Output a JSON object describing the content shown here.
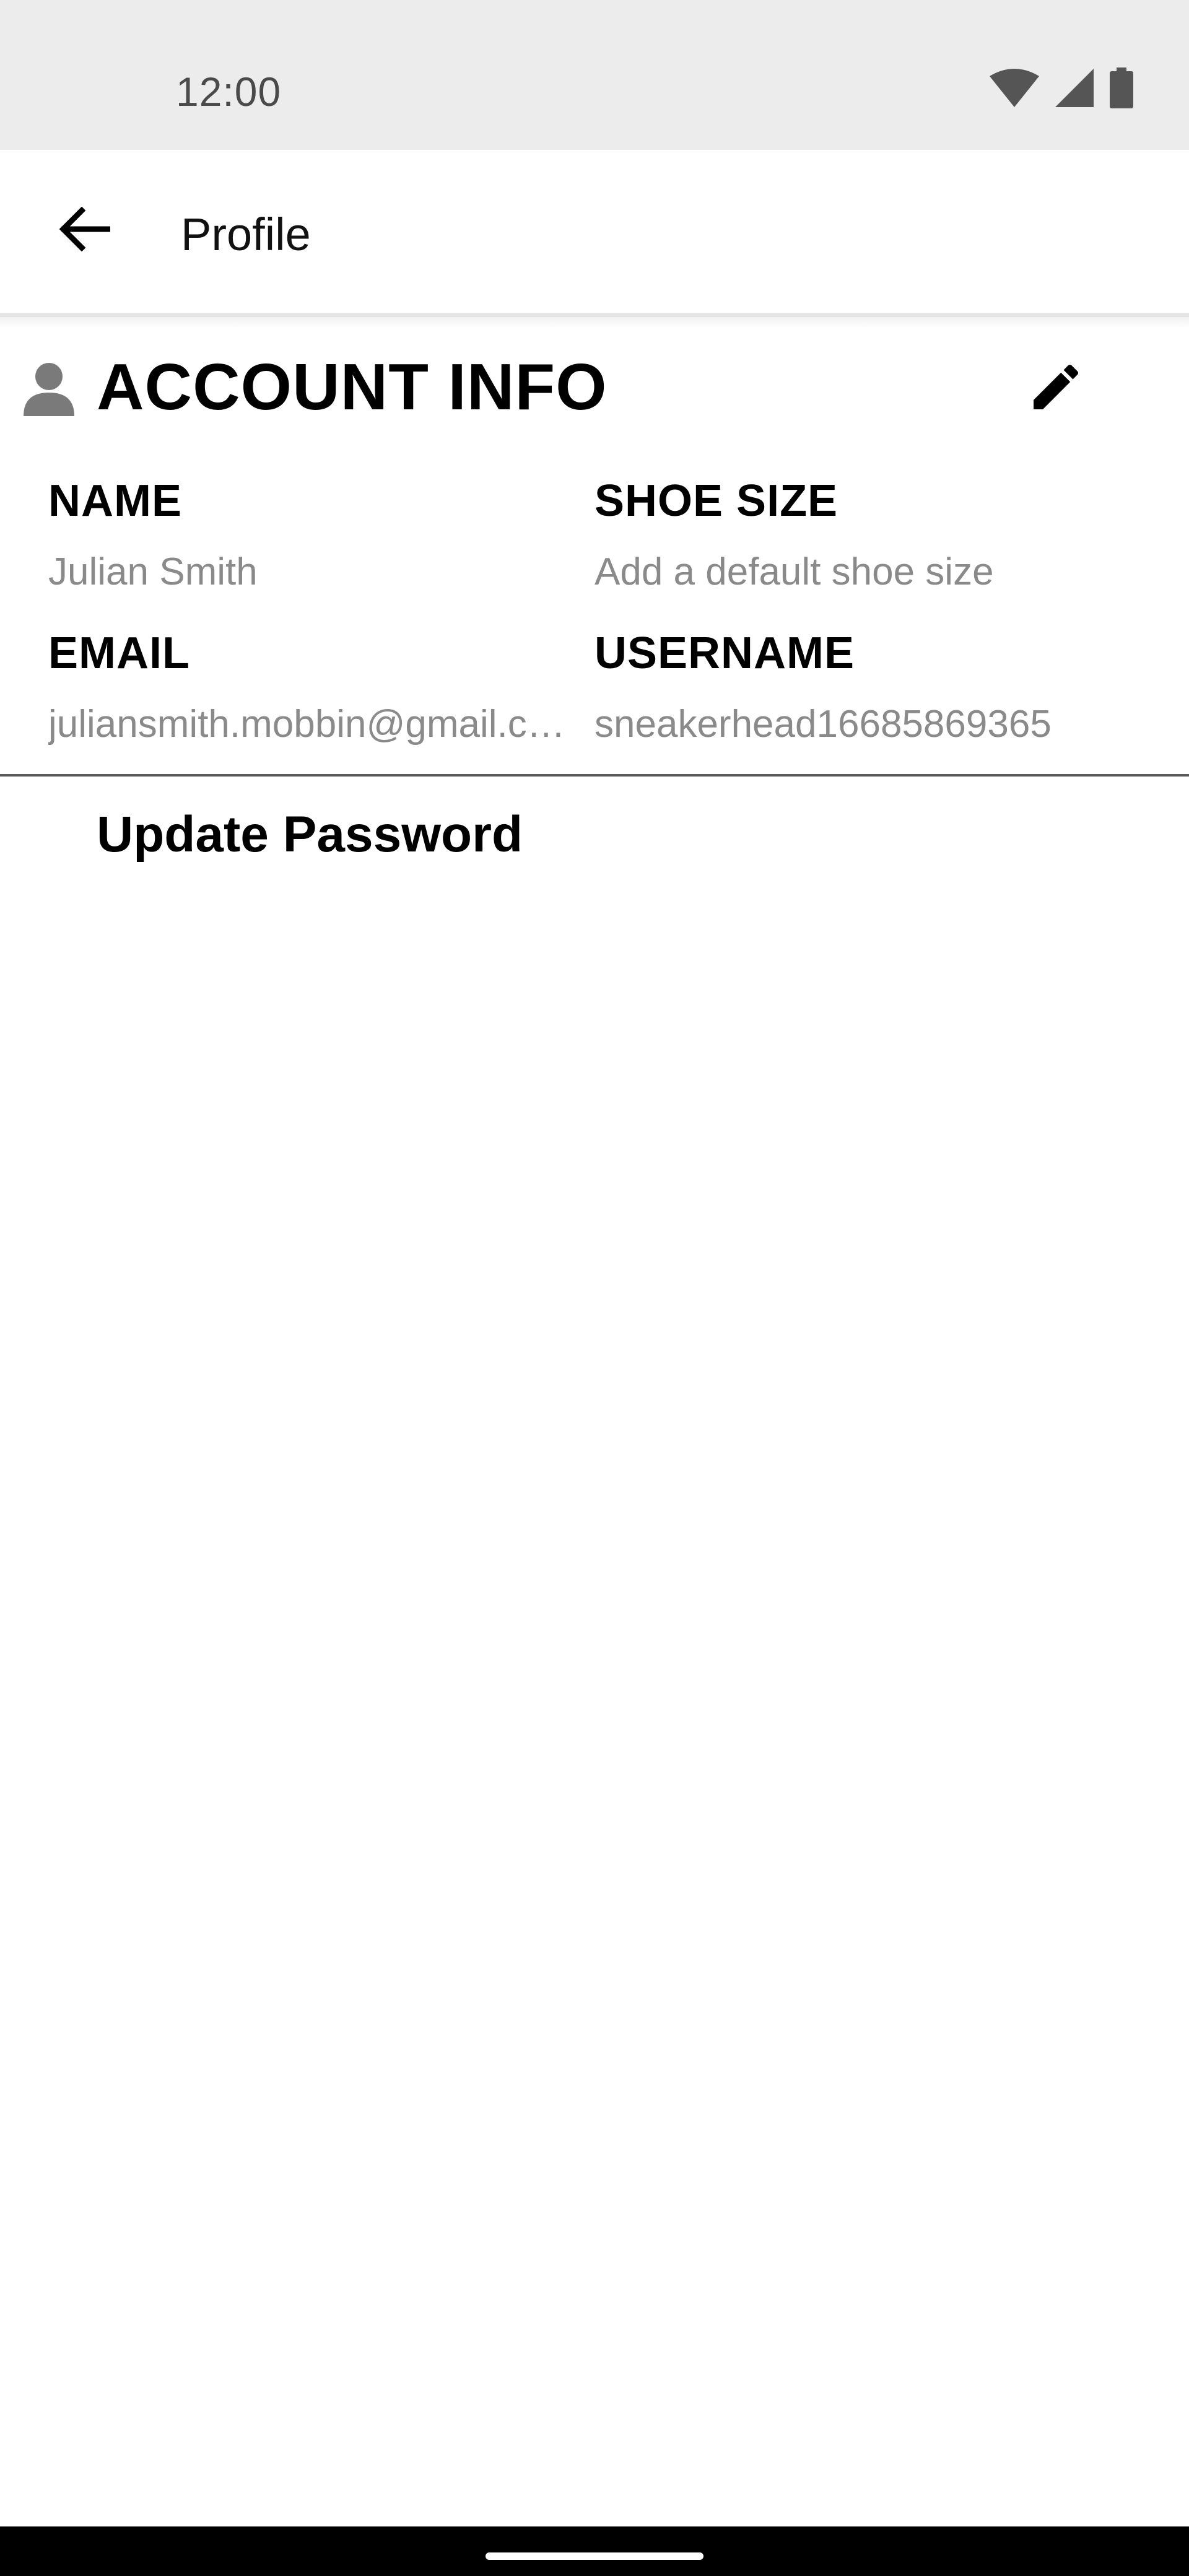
{
  "status_bar": {
    "time": "12:00",
    "icons": [
      "wifi-icon",
      "cellular-signal-icon",
      "battery-icon"
    ]
  },
  "app_bar": {
    "back_icon": "arrow-left-icon",
    "title": "Profile"
  },
  "account_info": {
    "icon": "person-icon",
    "title": "ACCOUNT INFO",
    "edit_icon": "pencil-icon",
    "fields": {
      "name": {
        "label": "NAME",
        "value": "Julian Smith"
      },
      "shoe_size": {
        "label": "SHOE SIZE",
        "value": "Add a default shoe size"
      },
      "email": {
        "label": "EMAIL",
        "value": "juliansmith.mobbin@gmail.com"
      },
      "username": {
        "label": "USERNAME",
        "value": "sneakerhead16685869365"
      }
    }
  },
  "actions": {
    "update_password": "Update Password"
  },
  "colors": {
    "status_bar_bg": "#ececec",
    "value_text": "#8a8a8a",
    "nav_bar_bg": "#000000"
  }
}
